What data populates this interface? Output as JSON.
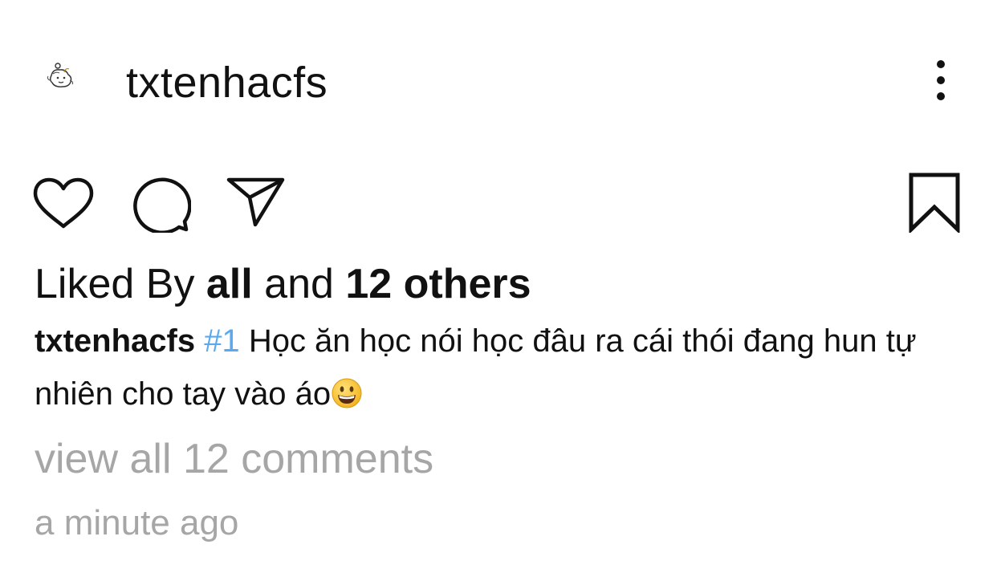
{
  "post": {
    "username": "txtenhacfs",
    "icons": {
      "avatar": "avatar-sketch-icon",
      "more": "more-vertical-icon",
      "like": "heart-icon",
      "comment": "comment-bubble-icon",
      "share": "paper-plane-icon",
      "save": "bookmark-icon",
      "emoji": "grinning-face-emoji"
    },
    "likes": {
      "prefix": "Liked By ",
      "highlight_user": "all",
      "middle": " and ",
      "others": "12 others"
    },
    "caption": {
      "username": "txtenhacfs",
      "hashtag": "#1",
      "text": "Học ăn học nói học đâu ra cái thói đang hun tự nhiên cho tay vào áo"
    },
    "view_comments": "view all 12 comments",
    "timestamp": "a minute ago",
    "colors": {
      "hashtag": "#5aa9f0",
      "muted": "#a6a6a6",
      "text": "#111111"
    }
  }
}
